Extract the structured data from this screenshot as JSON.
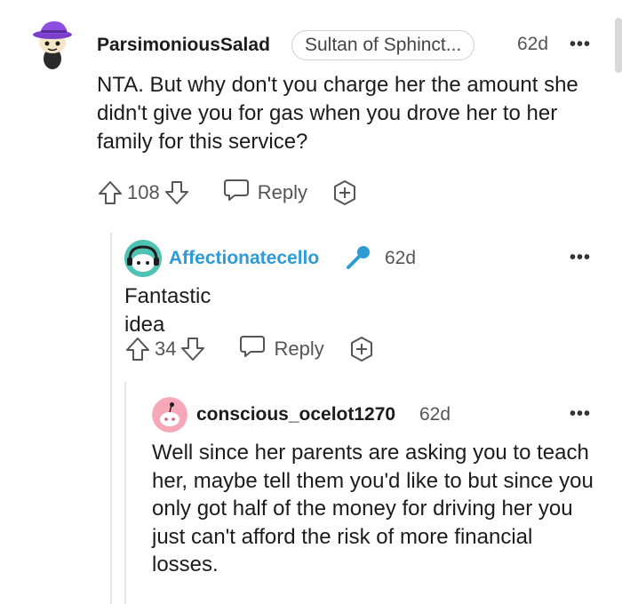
{
  "comments": [
    {
      "username": "ParsimoniousSalad",
      "flair": "Sultan of Sphinct...",
      "age": "62d",
      "more": "•••",
      "body": "NTA. But why don't you charge her the amount she didn't give you for gas when you drove her to her family for this service?",
      "votes": "108",
      "reply_label": "Reply",
      "avatar_icon": "snoo-purple-hat-avatar"
    },
    {
      "username": "Affectionatecello",
      "age": "62d",
      "more": "•••",
      "body": "Fantastic idea",
      "votes": "34",
      "reply_label": "Reply",
      "avatar_icon": "snoo-teal-headset-avatar",
      "badge_icon": "microphone-icon",
      "username_color": "#2f9bd4"
    },
    {
      "username": "conscious_ocelot1270",
      "age": "62d",
      "more": "•••",
      "body": "Well since her parents are asking you to teach her, maybe tell them you'd like to but since you only got half of the money for driving her you just can't afford the risk of more financial losses.",
      "avatar_icon": "snoo-pink-default-avatar"
    }
  ]
}
